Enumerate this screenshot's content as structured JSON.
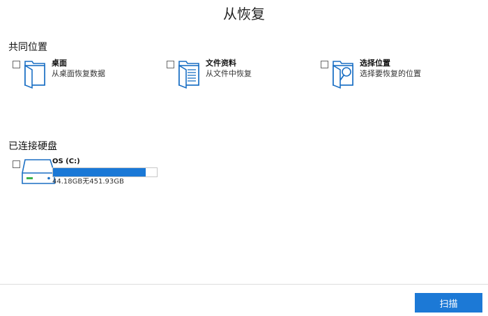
{
  "window": {
    "title": "从恢复"
  },
  "common_locations": {
    "heading": "共同位置",
    "items": [
      {
        "name": "桌面",
        "desc": "从桌面恢复数据",
        "icon": "desktop-folder-icon"
      },
      {
        "name": "文件资料",
        "desc": "从文件中恢复",
        "icon": "documents-icon"
      },
      {
        "name": "选择位置",
        "desc": "选择要恢复的位置",
        "icon": "folder-search-icon"
      }
    ]
  },
  "drives": {
    "heading": "已连接硬盘",
    "items": [
      {
        "name": "OS (C:)",
        "size_text": "44.18GB无451.93GB",
        "used_fraction": 0.89,
        "icon": "hard-drive-icon"
      }
    ]
  },
  "footer": {
    "scan_label": "扫描"
  },
  "colors": {
    "accent": "#1c79d6",
    "icon_blue": "#1a6fc4"
  }
}
